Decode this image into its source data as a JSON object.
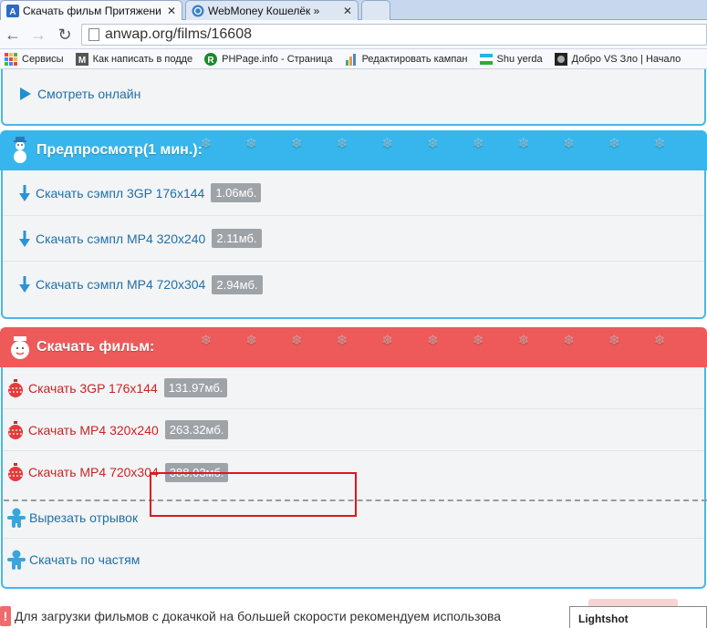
{
  "browser": {
    "tabs": [
      {
        "title": "Скачать фильм Притяжени",
        "active": true
      },
      {
        "title": "WebMoney Кошелёк »",
        "active": false
      }
    ],
    "url": "anwap.org/films/16608",
    "bookmarks": [
      {
        "label": "Сервисы",
        "icon": "apps-grid-icon"
      },
      {
        "label": "Как написать в подде",
        "icon": "m-logo-icon"
      },
      {
        "label": "PHPage.info - Страница",
        "icon": "green-r-icon"
      },
      {
        "label": "Редактировать кампан",
        "icon": "chart-icon"
      },
      {
        "label": "Shu yerda",
        "icon": "uz-flag-icon"
      },
      {
        "label": "Добро VS Зло | Начало",
        "icon": "game-icon"
      }
    ]
  },
  "top_card": {
    "watch_online": "Смотреть онлайн"
  },
  "preview": {
    "header": "Предпросмотр(1 мин.):",
    "items": [
      {
        "label": "Скачать сэмпл 3GP 176x144",
        "size": "1.06мб."
      },
      {
        "label": "Скачать сэмпл MP4 320x240",
        "size": "2.11мб."
      },
      {
        "label": "Скачать сэмпл MP4 720x304",
        "size": "2.94мб."
      }
    ]
  },
  "download": {
    "header": "Скачать фильм:",
    "items": [
      {
        "label": "Скачать 3GP 176x144",
        "size": "131.97мб."
      },
      {
        "label": "Скачать MP4 320x240",
        "size": "263.32мб."
      },
      {
        "label": "Скачать MP4 720x304",
        "size": "388.03мб."
      }
    ],
    "extra": [
      {
        "label": "Вырезать отрывок"
      },
      {
        "label": "Скачать по частям"
      }
    ]
  },
  "notice": {
    "text": "Для загрузки фильмов с докачкой на большей скорости рекомендуем использова"
  },
  "lightshot": "Lightshot",
  "colors": {
    "blue_header": "#36b6ec",
    "red_header": "#ee5a5a",
    "link_blue": "#1f6fa7",
    "link_red": "#cc2222",
    "highlight": "#e2141d"
  }
}
